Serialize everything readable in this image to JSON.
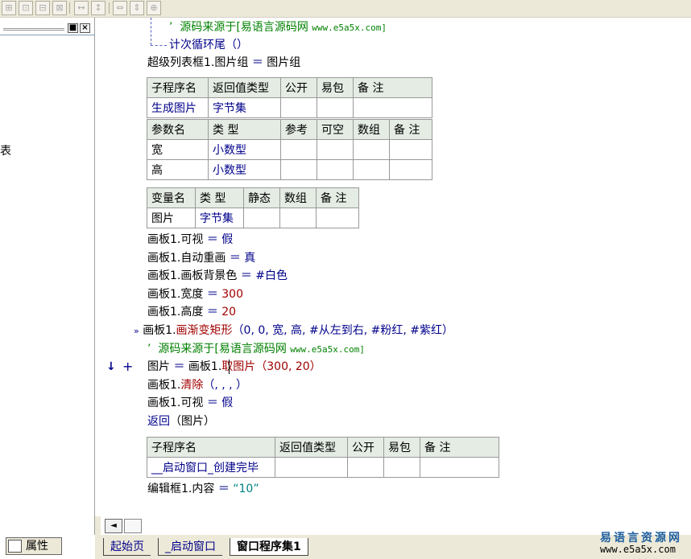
{
  "toolbar": {
    "icons": [
      "align-left-icon",
      "align-center-icon",
      "align-right-icon",
      "align-top-icon",
      "align-middle-icon",
      "align-bottom-icon",
      "same-width-icon",
      "same-height-icon",
      "same-size-icon"
    ]
  },
  "left_panel": {
    "title_buttons": {
      "restore": "■",
      "close": "×"
    },
    "edge_char": "表",
    "properties_tab": "属性"
  },
  "code": {
    "line_comment1_prefix": "’",
    "line_comment1": "源码来源于[易语言源码网",
    "line_comment1_url": "www.e5a5x.com]",
    "loop_end": "计次循环尾（）",
    "assign1": {
      "lhs": "超级列表框1.图片组",
      "op": "＝",
      "rhs": "图片组"
    },
    "sub_table": {
      "headers": [
        "子程序名",
        "返回值类型",
        "公开",
        "易包",
        "备 注"
      ],
      "row": [
        "生成图片",
        "字节集",
        "",
        "",
        ""
      ]
    },
    "param_table": {
      "headers": [
        "参数名",
        "类 型",
        "参考",
        "可空",
        "数组",
        "备 注"
      ],
      "rows": [
        [
          "宽",
          "小数型",
          "",
          "",
          "",
          ""
        ],
        [
          "高",
          "小数型",
          "",
          "",
          "",
          ""
        ]
      ]
    },
    "var_table": {
      "headers": [
        "变量名",
        "类 型",
        "静态",
        "数组",
        "备 注"
      ],
      "row": [
        "图片",
        "字节集",
        "",
        "",
        ""
      ]
    },
    "lines": [
      {
        "obj": "画板1.可视",
        "op": "＝",
        "val": "假"
      },
      {
        "obj": "画板1.自动重画",
        "op": "＝",
        "val": "真"
      },
      {
        "obj": "画板1.画板背景色",
        "op": "＝",
        "val": "#白色"
      },
      {
        "obj": "画板1.宽度",
        "op": "＝",
        "val": "300"
      },
      {
        "obj": "画板1.高度",
        "op": "＝",
        "val": "20"
      }
    ],
    "gradient_line": {
      "marker": "»",
      "obj": "画板1.",
      "method": "画渐变矩形",
      "args_plain": "（0, 0, 宽, 高, ",
      "args_const": "#从左到右, #粉红, #紫红",
      "close": "）"
    },
    "comment2_prefix": "’",
    "comment2": "源码来源于[易语言源码网",
    "comment2_url": "www.e5a5x.com]",
    "getpic_line": {
      "arrow": "↓",
      "plus": "+",
      "lhs": "图片",
      "op": "＝",
      "obj": "画板1.",
      "method": "取图片",
      "args": "（300, 20）"
    },
    "clear_line": {
      "obj": "画板1.",
      "method": "清除",
      "args": "（, , , ）"
    },
    "visible_line": {
      "obj": "画板1.可视",
      "op": "＝",
      "val": "假"
    },
    "return_line": {
      "kw": "返回",
      "args": "（图片）"
    },
    "sub2_table": {
      "headers": [
        "子程序名",
        "返回值类型",
        "公开",
        "易包",
        "备 注"
      ],
      "row": [
        "__启动窗口_创建完毕",
        "",
        "",
        "",
        ""
      ]
    },
    "last_line": {
      "obj": "编辑框1.内容",
      "op": "＝",
      "val": "“10”"
    }
  },
  "tabs": [
    "起始页",
    "_启动窗口",
    "窗口程序集1"
  ],
  "scroll": {
    "left_arrow": "◄"
  },
  "watermark": {
    "line1": "易语言资源网",
    "line2": "www.e5a5x.com"
  }
}
